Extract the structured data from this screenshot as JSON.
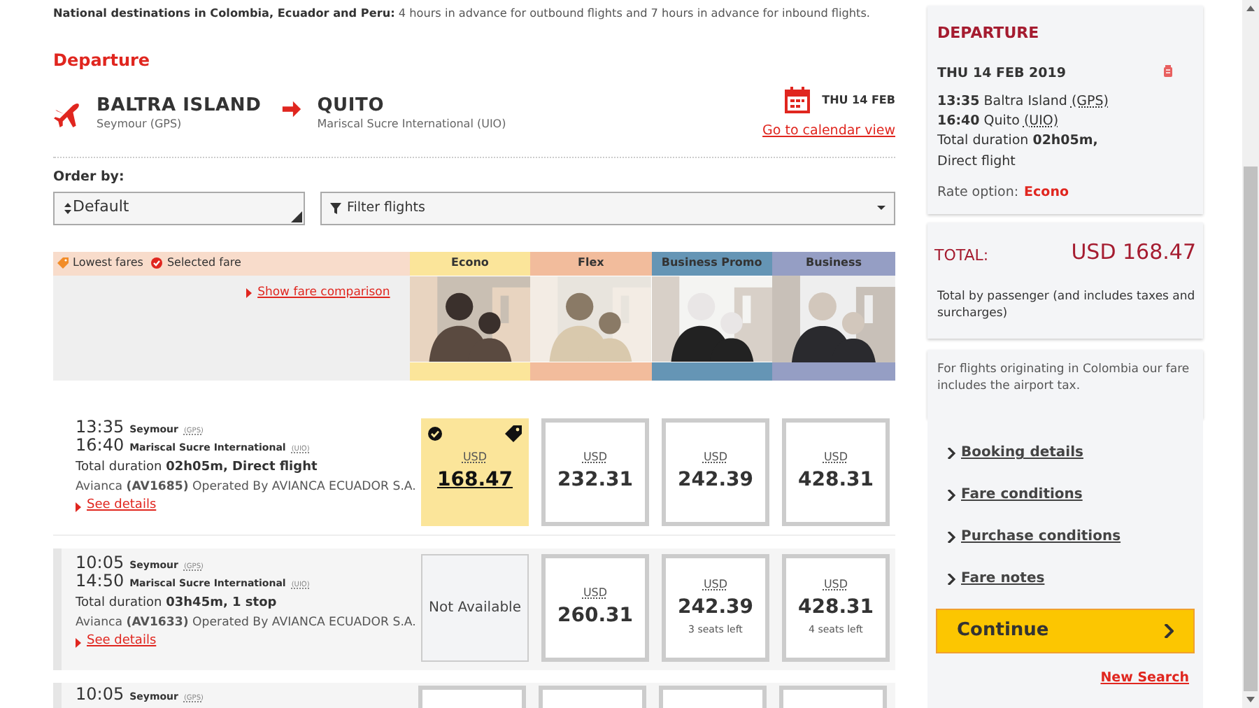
{
  "notice": "**National destinations in Colombia, Ecuador and Peru:** 4 hours in advance for outbound flights and 7 hours in advance for inbound flights.",
  "section_title": "Departure",
  "route": {
    "origin_city": "BALTRA ISLAND",
    "origin_airport": "Seymour (GPS)",
    "dest_city": "QUITO",
    "dest_airport": "Mariscal Sucre International (UIO)",
    "date": "THU 14 FEB",
    "calendar_link": "Go to calendar view"
  },
  "order_by": {
    "label": "Order by:",
    "value": "Default"
  },
  "filter": {
    "placeholder": "Filter flights"
  },
  "legend": [
    {
      "kind": "lowest",
      "text": "Lowest fares"
    },
    {
      "kind": "selected",
      "text": "Selected fare"
    }
  ],
  "comparison_link": "Show fare comparison",
  "fare_families": [
    {
      "name": "Econo",
      "color": "#fbe59a"
    },
    {
      "name": "Flex",
      "color": "#f2bc9c"
    },
    {
      "name": "Business Promo",
      "color": "#6595b5"
    },
    {
      "name": "Business",
      "color": "#959ec4"
    }
  ],
  "flights": [
    {
      "shaded": false,
      "depart_time": "13:35",
      "depart_airport": "Seymour",
      "depart_code": "(GPS)",
      "arrive_time": "16:40",
      "arrive_airport": "Mariscal Sucre International",
      "arrive_code": "(UIO)",
      "duration": "Total duration **02h05m, Direct flight**",
      "carrier": "Avianca **(AV1685)** Operated By AVIANCA ECUADOR S.A.",
      "details_link": "See details",
      "fares": [
        {
          "kind": "price",
          "currency": "USD",
          "price": "168.47",
          "selected": true,
          "lowest": true
        },
        {
          "kind": "price",
          "currency": "USD",
          "price": "232.31",
          "selected": false,
          "lowest": false
        },
        {
          "kind": "price",
          "currency": "USD",
          "price": "242.39",
          "selected": false,
          "lowest": false
        },
        {
          "kind": "price",
          "currency": "USD",
          "price": "428.31",
          "selected": false,
          "lowest": false
        }
      ]
    },
    {
      "shaded": true,
      "depart_time": "10:05",
      "depart_airport": "Seymour",
      "depart_code": "(GPS)",
      "arrive_time": "14:50",
      "arrive_airport": "Mariscal Sucre International",
      "arrive_code": "(UIO)",
      "duration": "Total duration **03h45m, 1 stop**",
      "carrier": "Avianca **(AV1633)** Operated By AVIANCA ECUADOR S.A.",
      "details_link": "See details",
      "fares": [
        {
          "kind": "unavailable",
          "text": "Not Available"
        },
        {
          "kind": "price",
          "currency": "USD",
          "price": "260.31",
          "selected": false,
          "lowest": false
        },
        {
          "kind": "price",
          "currency": "USD",
          "price": "242.39",
          "seats": "3 seats left",
          "selected": false,
          "lowest": false
        },
        {
          "kind": "price",
          "currency": "USD",
          "price": "428.31",
          "seats": "4 seats left",
          "selected": false,
          "lowest": false
        }
      ]
    },
    {
      "shaded": true,
      "depart_time": "10:05",
      "depart_airport": "Seymour",
      "depart_code": "(GPS)",
      "fares": [
        {
          "kind": "cut"
        },
        {
          "kind": "cut"
        },
        {
          "kind": "cut"
        },
        {
          "kind": "cut"
        }
      ]
    }
  ],
  "summary": {
    "title": "DEPARTURE",
    "date": "THU 14 FEB 2019",
    "legs": [
      {
        "time": "13:35",
        "place": "Baltra Island",
        "code": "(GPS)"
      },
      {
        "time": "16:40",
        "place": "Quito",
        "code": "(UIO)"
      }
    ],
    "duration": "Total duration **02h05m,** Direct flight",
    "rate_label": "Rate option:",
    "rate": "Econo"
  },
  "total": {
    "label": "TOTAL:",
    "amount": "USD 168.47",
    "note": "Total by passenger (and includes taxes and surcharges)"
  },
  "tax_note": "For flights originating in Colombia our fare includes the airport tax.",
  "links": [
    "Booking details",
    "Fare conditions",
    "Purchase conditions",
    "Fare notes"
  ],
  "continue": "Continue",
  "new_search": "New Search"
}
